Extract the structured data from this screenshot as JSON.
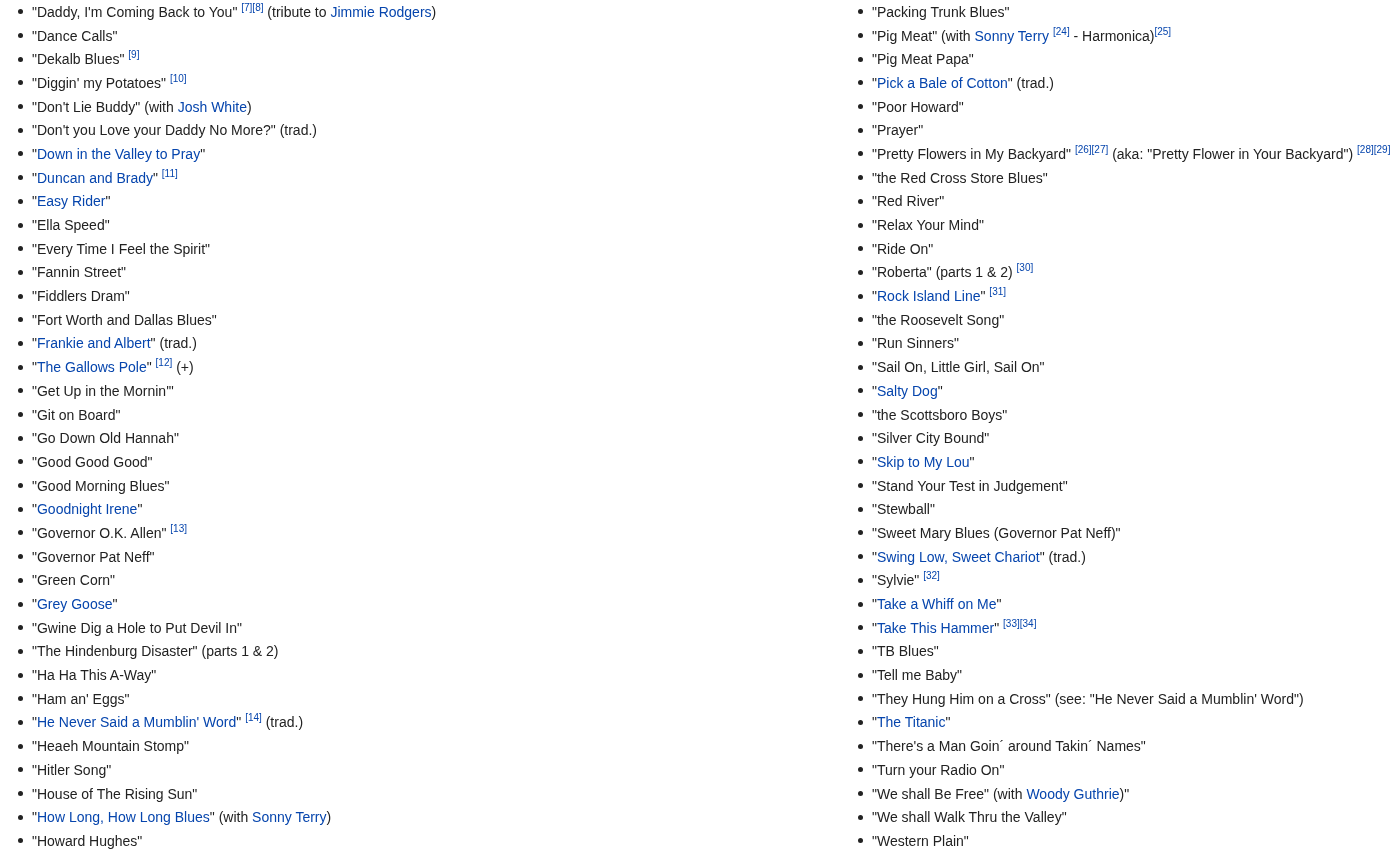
{
  "columns": [
    {
      "items": [
        [
          {
            "kind": "text",
            "text": "\"Daddy, I'm Coming Back to You\" "
          },
          {
            "kind": "ref",
            "text": "[7]"
          },
          {
            "kind": "ref",
            "text": "[8]"
          },
          {
            "kind": "text",
            "text": " (tribute to "
          },
          {
            "kind": "link",
            "text": "Jimmie Rodgers"
          },
          {
            "kind": "text",
            "text": ")"
          }
        ],
        [
          {
            "kind": "text",
            "text": "\"Dance Calls\""
          }
        ],
        [
          {
            "kind": "text",
            "text": "\"Dekalb Blues\" "
          },
          {
            "kind": "ref",
            "text": "[9]"
          }
        ],
        [
          {
            "kind": "text",
            "text": "\"Diggin' my Potatoes\" "
          },
          {
            "kind": "ref",
            "text": "[10]"
          }
        ],
        [
          {
            "kind": "text",
            "text": "\"Don't Lie Buddy\" (with "
          },
          {
            "kind": "link",
            "text": "Josh White"
          },
          {
            "kind": "text",
            "text": ")"
          }
        ],
        [
          {
            "kind": "text",
            "text": "\"Don't you Love your Daddy No More?\" (trad.)"
          }
        ],
        [
          {
            "kind": "text",
            "text": "\""
          },
          {
            "kind": "link",
            "text": "Down in the Valley to Pray"
          },
          {
            "kind": "text",
            "text": "\""
          }
        ],
        [
          {
            "kind": "text",
            "text": "\""
          },
          {
            "kind": "link",
            "text": "Duncan and Brady"
          },
          {
            "kind": "text",
            "text": "\" "
          },
          {
            "kind": "ref",
            "text": "[11]"
          }
        ],
        [
          {
            "kind": "text",
            "text": "\""
          },
          {
            "kind": "link",
            "text": "Easy Rider"
          },
          {
            "kind": "text",
            "text": "\""
          }
        ],
        [
          {
            "kind": "text",
            "text": "\"Ella Speed\""
          }
        ],
        [
          {
            "kind": "text",
            "text": "\"Every Time I Feel the Spirit\""
          }
        ],
        [
          {
            "kind": "text",
            "text": "\"Fannin Street\""
          }
        ],
        [
          {
            "kind": "text",
            "text": "\"Fiddlers Dram\""
          }
        ],
        [
          {
            "kind": "text",
            "text": "\"Fort Worth and Dallas Blues\""
          }
        ],
        [
          {
            "kind": "text",
            "text": "\""
          },
          {
            "kind": "link",
            "text": "Frankie and Albert"
          },
          {
            "kind": "text",
            "text": "\" (trad.)"
          }
        ],
        [
          {
            "kind": "text",
            "text": "\""
          },
          {
            "kind": "link",
            "text": "The Gallows Pole"
          },
          {
            "kind": "text",
            "text": "\" "
          },
          {
            "kind": "ref",
            "text": "[12]"
          },
          {
            "kind": "text",
            "text": " (+)"
          }
        ],
        [
          {
            "kind": "text",
            "text": "\"Get Up in the Mornin'\""
          }
        ],
        [
          {
            "kind": "text",
            "text": "\"Git on Board\""
          }
        ],
        [
          {
            "kind": "text",
            "text": "\"Go Down Old Hannah\""
          }
        ],
        [
          {
            "kind": "text",
            "text": "\"Good Good Good\""
          }
        ],
        [
          {
            "kind": "text",
            "text": "\"Good Morning Blues\""
          }
        ],
        [
          {
            "kind": "text",
            "text": "\""
          },
          {
            "kind": "link",
            "text": "Goodnight Irene"
          },
          {
            "kind": "text",
            "text": "\""
          }
        ],
        [
          {
            "kind": "text",
            "text": "\"Governor O.K. Allen\" "
          },
          {
            "kind": "ref",
            "text": "[13]"
          }
        ],
        [
          {
            "kind": "text",
            "text": "\"Governor Pat Neff\""
          }
        ],
        [
          {
            "kind": "text",
            "text": "\"Green Corn\""
          }
        ],
        [
          {
            "kind": "text",
            "text": "\""
          },
          {
            "kind": "link",
            "text": "Grey Goose"
          },
          {
            "kind": "text",
            "text": "\""
          }
        ],
        [
          {
            "kind": "text",
            "text": "\"Gwine Dig a Hole to Put Devil In\""
          }
        ],
        [
          {
            "kind": "text",
            "text": "\"The Hindenburg Disaster\" (parts 1 & 2)"
          }
        ],
        [
          {
            "kind": "text",
            "text": "\"Ha Ha This A-Way\""
          }
        ],
        [
          {
            "kind": "text",
            "text": "\"Ham an' Eggs\""
          }
        ],
        [
          {
            "kind": "text",
            "text": "\""
          },
          {
            "kind": "link",
            "text": "He Never Said a Mumblin' Word"
          },
          {
            "kind": "text",
            "text": "\" "
          },
          {
            "kind": "ref",
            "text": "[14]"
          },
          {
            "kind": "text",
            "text": " (trad.)"
          }
        ],
        [
          {
            "kind": "text",
            "text": "\"Heaeh Mountain Stomp\""
          }
        ],
        [
          {
            "kind": "text",
            "text": "\"Hitler Song\""
          }
        ],
        [
          {
            "kind": "text",
            "text": "\"House of The Rising Sun\""
          }
        ],
        [
          {
            "kind": "text",
            "text": "\""
          },
          {
            "kind": "link",
            "text": "How Long, How Long Blues"
          },
          {
            "kind": "text",
            "text": "\" (with "
          },
          {
            "kind": "link",
            "text": "Sonny Terry"
          },
          {
            "kind": "text",
            "text": ")"
          }
        ],
        [
          {
            "kind": "text",
            "text": "\"Howard Hughes\""
          }
        ]
      ]
    },
    {
      "items": [
        [
          {
            "kind": "text",
            "text": "\"Packing Trunk Blues\""
          }
        ],
        [
          {
            "kind": "text",
            "text": "\"Pig Meat\" (with "
          },
          {
            "kind": "link",
            "text": "Sonny Terry"
          },
          {
            "kind": "ref",
            "text": "[24]",
            "spaced": true
          },
          {
            "kind": "text",
            "text": " - Harmonica)"
          },
          {
            "kind": "ref",
            "text": "[25]"
          }
        ],
        [
          {
            "kind": "text",
            "text": "\"Pig Meat Papa\""
          }
        ],
        [
          {
            "kind": "text",
            "text": "\""
          },
          {
            "kind": "link",
            "text": "Pick a Bale of Cotton"
          },
          {
            "kind": "text",
            "text": "\" (trad.)"
          }
        ],
        [
          {
            "kind": "text",
            "text": "\"Poor Howard\""
          }
        ],
        [
          {
            "kind": "text",
            "text": "\"Prayer\""
          }
        ],
        [
          {
            "kind": "text",
            "text": "\"Pretty Flowers in My Backyard\" "
          },
          {
            "kind": "ref",
            "text": "[26]"
          },
          {
            "kind": "ref",
            "text": "[27]"
          },
          {
            "kind": "text",
            "text": " (aka: \"Pretty Flower in Your Backyard\") "
          },
          {
            "kind": "ref",
            "text": "[28]"
          },
          {
            "kind": "ref",
            "text": "[29]"
          }
        ],
        [
          {
            "kind": "text",
            "text": "\"the Red Cross Store Blues\""
          }
        ],
        [
          {
            "kind": "text",
            "text": "\"Red River\""
          }
        ],
        [
          {
            "kind": "text",
            "text": "\"Relax Your Mind\""
          }
        ],
        [
          {
            "kind": "text",
            "text": "\"Ride On\""
          }
        ],
        [
          {
            "kind": "text",
            "text": "\"Roberta\" (parts 1 & 2) "
          },
          {
            "kind": "ref",
            "text": "[30]"
          }
        ],
        [
          {
            "kind": "text",
            "text": "\""
          },
          {
            "kind": "link",
            "text": "Rock Island Line"
          },
          {
            "kind": "text",
            "text": "\" "
          },
          {
            "kind": "ref",
            "text": "[31]"
          }
        ],
        [
          {
            "kind": "text",
            "text": "\"the Roosevelt Song\""
          }
        ],
        [
          {
            "kind": "text",
            "text": "\"Run Sinners\""
          }
        ],
        [
          {
            "kind": "text",
            "text": "\"Sail On, Little Girl, Sail On\""
          }
        ],
        [
          {
            "kind": "text",
            "text": "\""
          },
          {
            "kind": "link",
            "text": "Salty Dog"
          },
          {
            "kind": "text",
            "text": "\""
          }
        ],
        [
          {
            "kind": "text",
            "text": "\"the Scottsboro Boys\""
          }
        ],
        [
          {
            "kind": "text",
            "text": "\"Silver City Bound\""
          }
        ],
        [
          {
            "kind": "text",
            "text": "\""
          },
          {
            "kind": "link",
            "text": "Skip to My Lou"
          },
          {
            "kind": "text",
            "text": "\""
          }
        ],
        [
          {
            "kind": "text",
            "text": "\"Stand Your Test in Judgement\""
          }
        ],
        [
          {
            "kind": "text",
            "text": "\"Stewball\""
          }
        ],
        [
          {
            "kind": "text",
            "text": "\"Sweet Mary Blues (Governor Pat Neff)\""
          }
        ],
        [
          {
            "kind": "text",
            "text": "\""
          },
          {
            "kind": "link",
            "text": "Swing Low, Sweet Chariot"
          },
          {
            "kind": "text",
            "text": "\" (trad.)"
          }
        ],
        [
          {
            "kind": "text",
            "text": "\"Sylvie\" "
          },
          {
            "kind": "ref",
            "text": "[32]"
          }
        ],
        [
          {
            "kind": "text",
            "text": "\""
          },
          {
            "kind": "link",
            "text": "Take a Whiff on Me"
          },
          {
            "kind": "text",
            "text": "\""
          }
        ],
        [
          {
            "kind": "text",
            "text": "\""
          },
          {
            "kind": "link",
            "text": "Take This Hammer"
          },
          {
            "kind": "text",
            "text": "\" "
          },
          {
            "kind": "ref",
            "text": "[33]"
          },
          {
            "kind": "ref",
            "text": "[34]"
          }
        ],
        [
          {
            "kind": "text",
            "text": "\"TB Blues\""
          }
        ],
        [
          {
            "kind": "text",
            "text": "\"Tell me Baby\""
          }
        ],
        [
          {
            "kind": "text",
            "text": "\"They Hung Him on a Cross\" (see: \"He Never Said a Mumblin' Word\")"
          }
        ],
        [
          {
            "kind": "text",
            "text": "\""
          },
          {
            "kind": "link",
            "text": "The Titanic"
          },
          {
            "kind": "text",
            "text": "\""
          }
        ],
        [
          {
            "kind": "text",
            "text": "\"There's a Man Goin´ around Takin´ Names\""
          }
        ],
        [
          {
            "kind": "text",
            "text": "\"Turn your Radio On\""
          }
        ],
        [
          {
            "kind": "text",
            "text": "\"We shall Be Free\" (with "
          },
          {
            "kind": "link",
            "text": "Woody Guthrie"
          },
          {
            "kind": "text",
            "text": ")\""
          }
        ],
        [
          {
            "kind": "text",
            "text": "\"We shall Walk Thru the Valley\""
          }
        ],
        [
          {
            "kind": "text",
            "text": "\"Western Plain\""
          }
        ]
      ]
    }
  ]
}
